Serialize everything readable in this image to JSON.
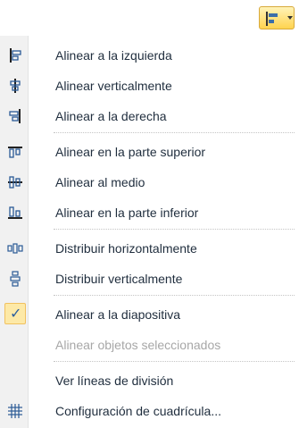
{
  "menu": {
    "items": [
      {
        "label": "Alinear a la izquierda",
        "icon": "align-left-icon"
      },
      {
        "label": "Alinear verticalmente",
        "icon": "align-center-icon"
      },
      {
        "label": "Alinear a la derecha",
        "icon": "align-right-icon"
      },
      {
        "label": "Alinear en la parte superior",
        "icon": "align-top-icon"
      },
      {
        "label": "Alinear al medio",
        "icon": "align-middle-icon"
      },
      {
        "label": "Alinear en la parte inferior",
        "icon": "align-bottom-icon"
      },
      {
        "label": "Distribuir horizontalmente",
        "icon": "distribute-horizontal-icon"
      },
      {
        "label": "Distribuir verticalmente",
        "icon": "distribute-vertical-icon"
      },
      {
        "label": "Alinear a la diapositiva",
        "icon": "checkmark-icon",
        "checked": true
      },
      {
        "label": "Alinear objetos seleccionados",
        "disabled": true
      },
      {
        "label": "Ver líneas de división"
      },
      {
        "label": "Configuración de cuadrícula...",
        "icon": "grid-icon"
      }
    ]
  },
  "toolbar": {
    "button_icon": "align-left-icon"
  }
}
